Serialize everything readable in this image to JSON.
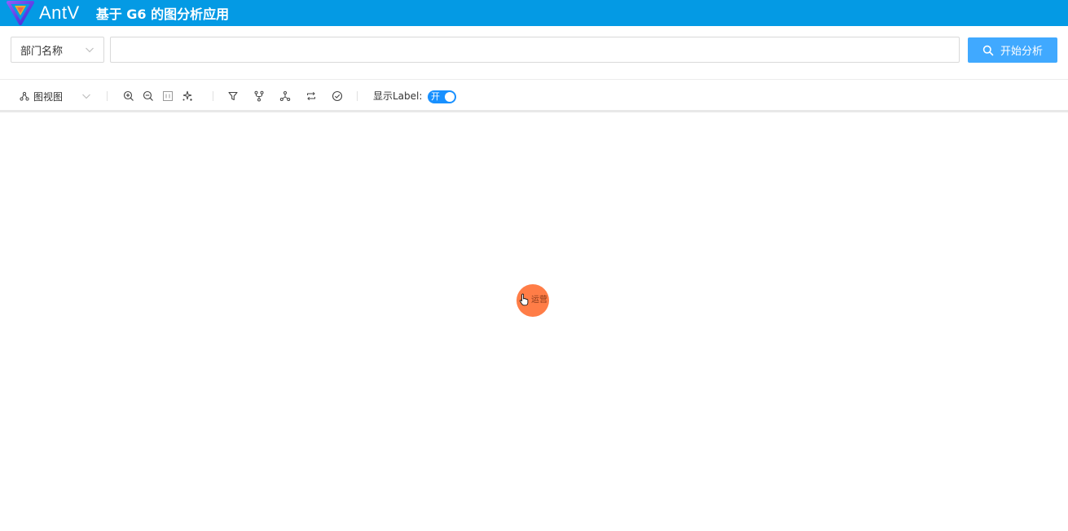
{
  "header": {
    "logo_text": "AntV",
    "title": "基于 G6 的图分析应用",
    "background": "#049ae4"
  },
  "search": {
    "field_select_value": "部门名称",
    "input_value": "",
    "button_label": "开始分析",
    "button_icon": "search-icon",
    "accent": "#40a9ff"
  },
  "toolbar": {
    "view_select_value": "图视图",
    "view_select_icon": "graph-view-icon",
    "zoom_icons": [
      "zoom-in-icon",
      "zoom-out-icon",
      "fit-view-icon",
      "auto-layout-icon"
    ],
    "action_icons": [
      "filter-icon",
      "fork-icon",
      "cluster-icon",
      "swap-icon",
      "check-circle-icon"
    ],
    "label_toggle_text": "显示Label:",
    "label_toggle_state": "开",
    "toggle_color": "#1890ff"
  },
  "canvas": {
    "node": {
      "label": "运营",
      "color": "#ff7d47"
    },
    "cursor_icon": "hand-pointer-icon"
  }
}
